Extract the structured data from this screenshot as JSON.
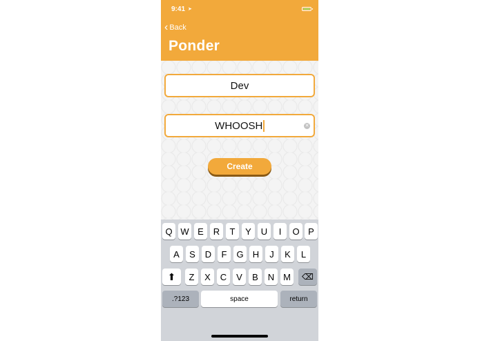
{
  "status": {
    "time": "9:41"
  },
  "nav": {
    "back_label": "Back",
    "title": "Ponder"
  },
  "form": {
    "field1_value": "Dev",
    "field2_value": "WHOOSH",
    "create_label": "Create"
  },
  "keyboard": {
    "row1": [
      "Q",
      "W",
      "E",
      "R",
      "T",
      "Y",
      "U",
      "I",
      "O",
      "P"
    ],
    "row2": [
      "A",
      "S",
      "D",
      "F",
      "G",
      "H",
      "J",
      "K",
      "L"
    ],
    "row3": [
      "Z",
      "X",
      "C",
      "V",
      "B",
      "N",
      "M"
    ],
    "numbers_label": ".?123",
    "space_label": "space",
    "return_label": "return"
  },
  "colors": {
    "accent": "#f2a93b",
    "button_shadow": "#8a5a15",
    "keyboard_bg": "#d1d4d9"
  }
}
